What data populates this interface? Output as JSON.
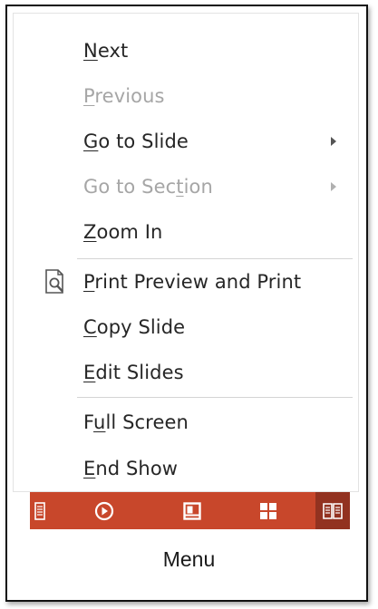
{
  "menu": {
    "items": [
      {
        "id": "next",
        "pre": "",
        "key": "N",
        "post": "ext",
        "enabled": true,
        "submenu": false
      },
      {
        "id": "previous",
        "pre": "",
        "key": "P",
        "post": "revious",
        "enabled": false,
        "submenu": false
      },
      {
        "id": "go-to-slide",
        "pre": "",
        "key": "G",
        "post": "o to Slide",
        "enabled": true,
        "submenu": true
      },
      {
        "id": "go-to-section",
        "pre": "Go to Sec",
        "key": "t",
        "post": "ion",
        "enabled": false,
        "submenu": true
      },
      {
        "id": "zoom-in",
        "pre": "",
        "key": "Z",
        "post": "oom In",
        "enabled": true,
        "submenu": false
      },
      {
        "id": "print-preview",
        "pre": "",
        "key": "P",
        "post": "rint Preview and Print",
        "enabled": true,
        "submenu": false,
        "icon": "print-preview-icon"
      },
      {
        "id": "copy-slide",
        "pre": "",
        "key": "C",
        "post": "opy Slide",
        "enabled": true,
        "submenu": false
      },
      {
        "id": "edit-slides",
        "pre": "",
        "key": "E",
        "post": "dit Slides",
        "enabled": true,
        "submenu": false
      },
      {
        "id": "full-screen",
        "pre": "F",
        "key": "u",
        "post": "ll Screen",
        "enabled": true,
        "submenu": false
      },
      {
        "id": "end-show",
        "pre": "",
        "key": "E",
        "post": "nd Show",
        "enabled": true,
        "submenu": false
      }
    ]
  },
  "toolbar": {
    "buttons": [
      {
        "id": "notes-view",
        "icon": "notes-page-icon"
      },
      {
        "id": "slide-show",
        "icon": "play-circle-icon"
      },
      {
        "id": "normal-view",
        "icon": "normal-view-icon"
      },
      {
        "id": "slide-sorter",
        "icon": "grid-icon"
      },
      {
        "id": "reading-view",
        "icon": "reading-view-icon",
        "active": true
      }
    ],
    "colors": {
      "bar": "#c8472b",
      "active": "#923220",
      "icon": "#ffffff"
    }
  },
  "caption": "Menu"
}
